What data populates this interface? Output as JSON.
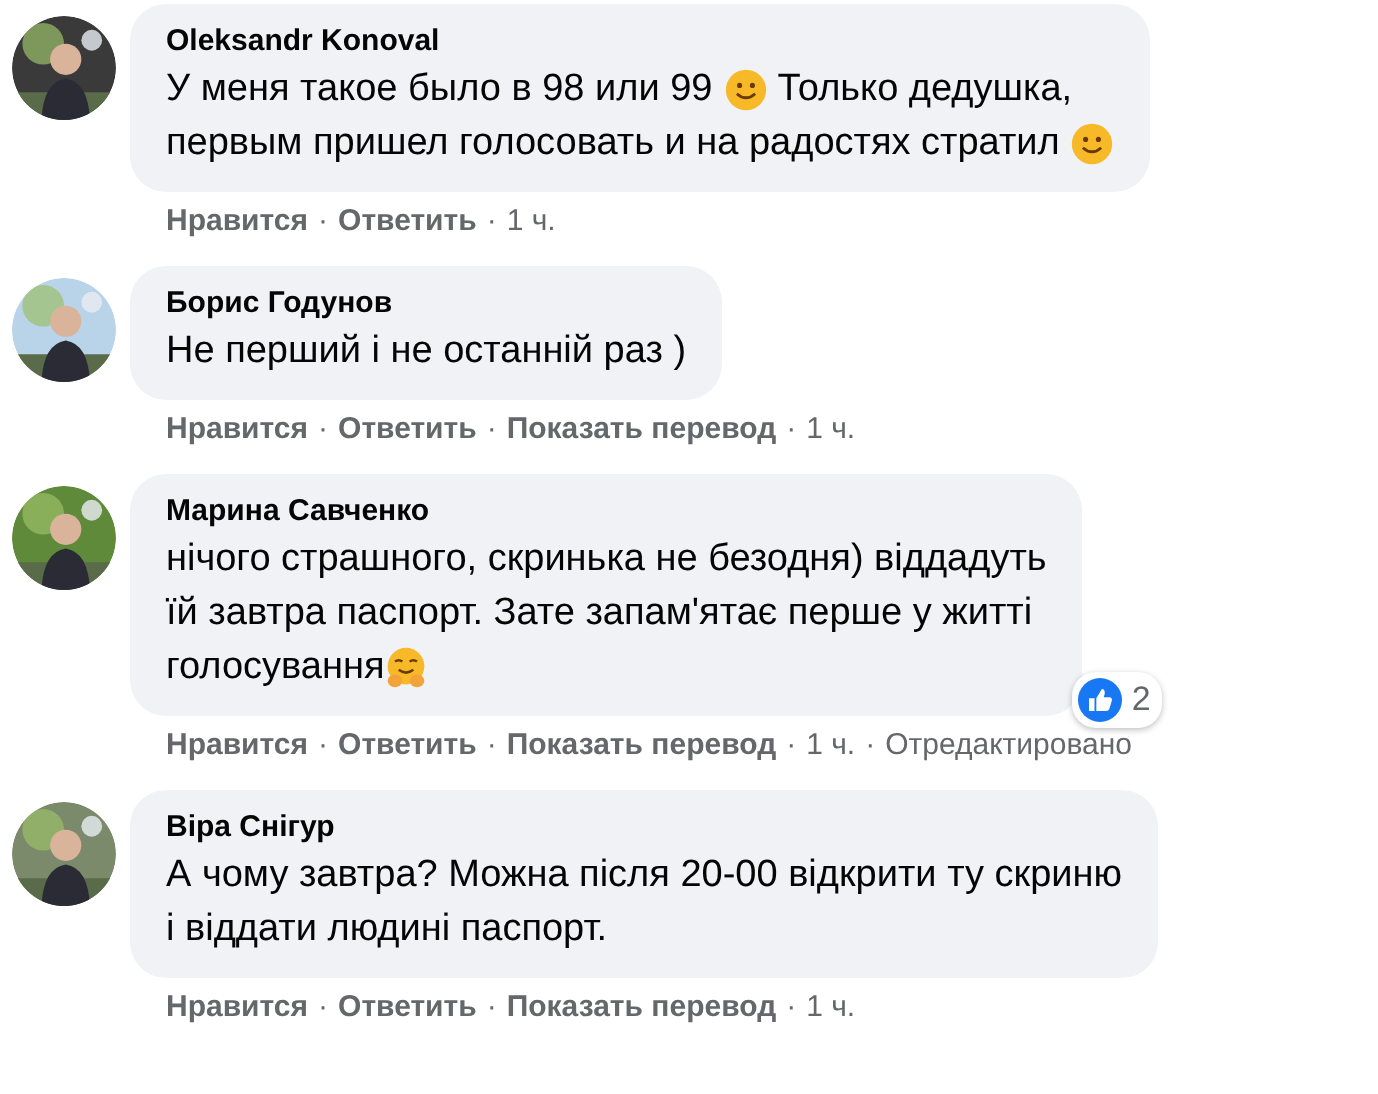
{
  "comments": [
    {
      "avatar": {
        "kind": "picture"
      },
      "author": "Oleksandr Konoval",
      "lines": [
        [
          {
            "kind": "text",
            "text": "У меня такое было в 98 или 99 "
          },
          {
            "kind": "smile"
          },
          {
            "kind": "text",
            "text": " Только дедушка,"
          }
        ],
        [
          {
            "kind": "text",
            "text": "первым пришел голосовать и на радостях стратил "
          },
          {
            "kind": "smile"
          }
        ]
      ],
      "actions": [
        {
          "kind": "link",
          "text": "Нравится"
        },
        {
          "kind": "separator",
          "text": "·"
        },
        {
          "kind": "link",
          "text": "Ответить"
        },
        {
          "kind": "separator",
          "text": "·"
        },
        {
          "kind": "plain",
          "text": "1 ч."
        }
      ]
    },
    {
      "avatar": {
        "kind": "picture"
      },
      "author": "Борис Годунов",
      "lines": [
        [
          {
            "kind": "text",
            "text": "Не перший і не останній раз )"
          }
        ]
      ],
      "actions": [
        {
          "kind": "link",
          "text": "Нравится"
        },
        {
          "kind": "separator",
          "text": "·"
        },
        {
          "kind": "link",
          "text": "Ответить"
        },
        {
          "kind": "separator",
          "text": "·"
        },
        {
          "kind": "link",
          "text": "Показать перевод"
        },
        {
          "kind": "separator",
          "text": "·"
        },
        {
          "kind": "plain",
          "text": "1 ч."
        }
      ]
    },
    {
      "avatar": {
        "kind": "picture"
      },
      "author": "Марина Савченко",
      "lines": [
        [
          {
            "kind": "text",
            "text": "нічого страшного, скринька не безодня) віддадуть"
          }
        ],
        [
          {
            "kind": "text",
            "text": "їй завтра паспорт. Зате запам'ятає перше у житті"
          }
        ],
        [
          {
            "kind": "text",
            "text": "голосування"
          },
          {
            "kind": "hug"
          }
        ]
      ],
      "reaction": {
        "count": "2"
      },
      "actions": [
        {
          "kind": "link",
          "text": "Нравится"
        },
        {
          "kind": "separator",
          "text": "·"
        },
        {
          "kind": "link",
          "text": "Ответить"
        },
        {
          "kind": "separator",
          "text": "·"
        },
        {
          "kind": "link",
          "text": "Показать перевод"
        },
        {
          "kind": "separator",
          "text": "·"
        },
        {
          "kind": "plain",
          "text": "1 ч."
        },
        {
          "kind": "separator",
          "text": "·"
        },
        {
          "kind": "plain",
          "text": "Отредактировано"
        }
      ]
    },
    {
      "avatar": {
        "kind": "picture"
      },
      "author": "Віра Снігур",
      "lines": [
        [
          {
            "kind": "text",
            "text": "А чому завтра? Можна після 20-00 відкрити ту скриню"
          }
        ],
        [
          {
            "kind": "text",
            "text": "і віддати людині паспорт."
          }
        ]
      ],
      "actions": [
        {
          "kind": "link",
          "text": "Нравится"
        },
        {
          "kind": "separator",
          "text": "·"
        },
        {
          "kind": "link",
          "text": "Ответить"
        },
        {
          "kind": "separator",
          "text": "·"
        },
        {
          "kind": "link",
          "text": "Показать перевод"
        },
        {
          "kind": "separator",
          "text": "·"
        },
        {
          "kind": "plain",
          "text": "1 ч."
        }
      ]
    }
  ]
}
